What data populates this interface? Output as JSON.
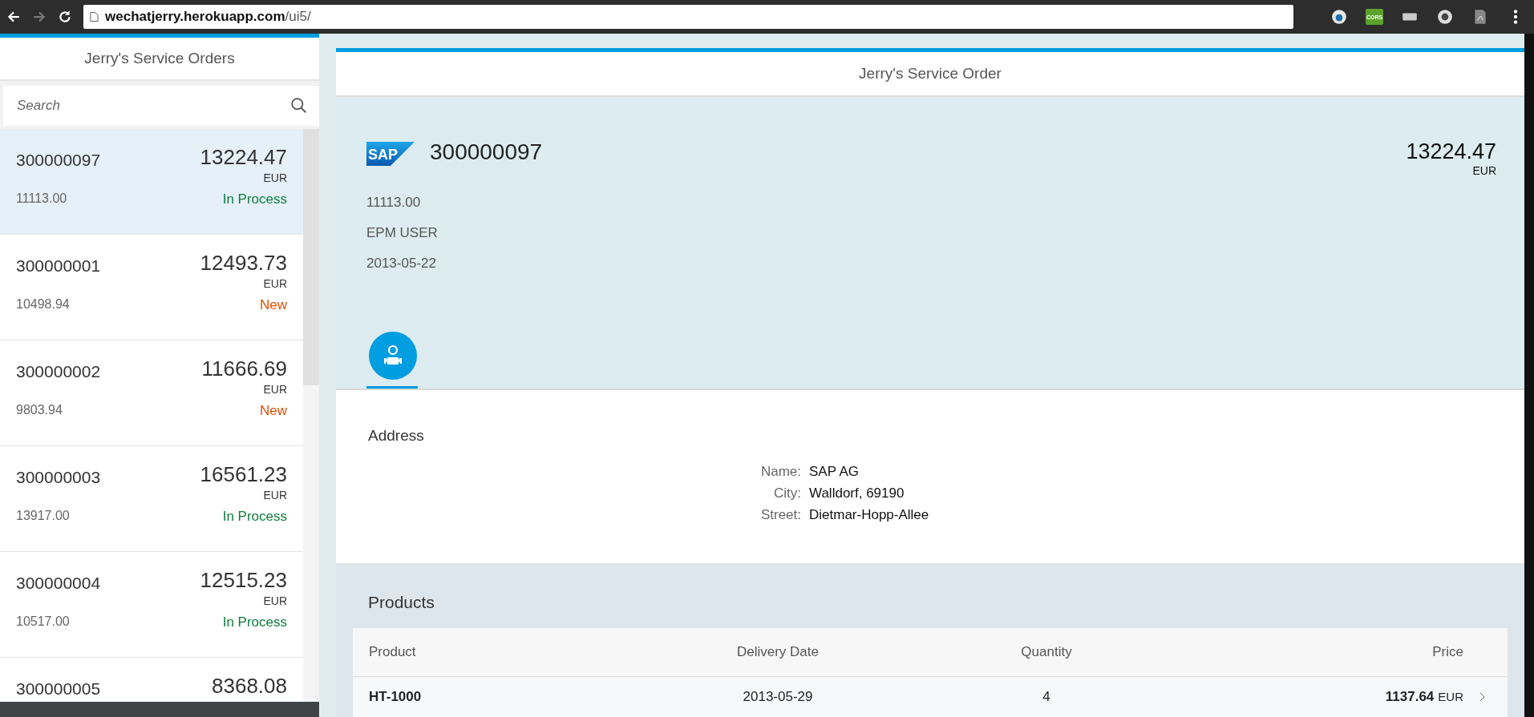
{
  "browser": {
    "url": "**wechatjerry.herokuapp.com**/ui5/",
    "forward_disabled": true,
    "extensions": [
      {
        "kind": "round"
      },
      {
        "kind": "badge",
        "label": "CORS"
      },
      {
        "kind": "chip"
      },
      {
        "kind": "ring"
      },
      {
        "kind": "doc"
      }
    ]
  },
  "master": {
    "title": "Jerry's Service Orders",
    "search": {
      "placeholder": "Search"
    },
    "items": [
      {
        "id": "300000097",
        "amount": "13224.47",
        "currency": "EUR",
        "net": "11113.00",
        "status": "In Process",
        "color": "#107e3e",
        "selected": true
      },
      {
        "id": "300000001",
        "amount": "12493.73",
        "currency": "EUR",
        "net": "10498.94",
        "status": "New",
        "color": "#e34f00",
        "selected": false
      },
      {
        "id": "300000002",
        "amount": "11666.69",
        "currency": "EUR",
        "net": "9803.94",
        "status": "New",
        "color": "#e34f00",
        "selected": false
      },
      {
        "id": "300000003",
        "amount": "16561.23",
        "currency": "EUR",
        "net": "13917.00",
        "status": "In Process",
        "color": "#107e3e",
        "selected": false
      },
      {
        "id": "300000004",
        "amount": "12515.23",
        "currency": "EUR",
        "net": "10517.00",
        "status": "In Process",
        "color": "#107e3e",
        "selected": false
      },
      {
        "id": "300000005",
        "amount": "8368.08",
        "selected": false
      }
    ]
  },
  "detail": {
    "title": "Jerry's Service Order",
    "header": {
      "logo": "SAP",
      "number": "300000097",
      "amount": "13224.47",
      "currency": "EUR",
      "attributes": [
        "11113.00",
        "EPM USER",
        "2013-05-22"
      ]
    },
    "icon_tabs": [
      {
        "selected": true
      }
    ],
    "address": {
      "title": "Address",
      "fields": [
        {
          "label": "Name:",
          "value": "SAP AG"
        },
        {
          "label": "City:",
          "value": "Walldorf, 69190"
        },
        {
          "label": "Street:",
          "value": "Dietmar-Hopp-Allee"
        }
      ]
    },
    "products": {
      "title": "Products",
      "columns": [
        "Product",
        "Delivery Date",
        "Quantity",
        "Price"
      ],
      "rows": [
        {
          "product": "HT-1000",
          "date": "2013-05-29",
          "quantity": "4",
          "price": "1137.64",
          "currency": "EUR"
        }
      ]
    }
  }
}
